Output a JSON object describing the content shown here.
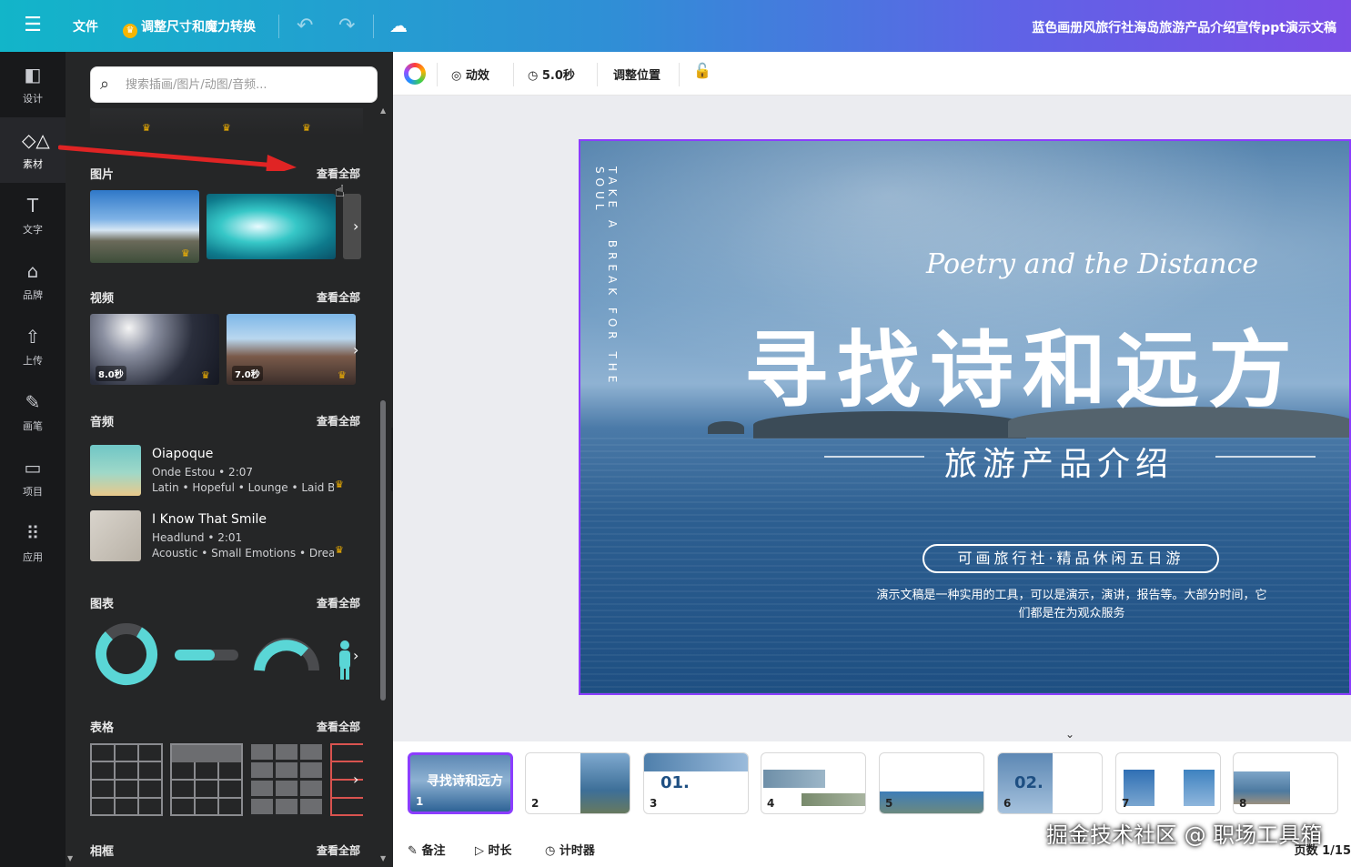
{
  "topbar": {
    "menu_icon": "menu-icon",
    "file_label": "文件",
    "resize_label": "调整尺寸和魔力转换",
    "doc_title": "蓝色画册风旅行社海岛旅游产品介绍宣传ppt演示文稿"
  },
  "rail": {
    "items": [
      {
        "icon": "design-icon",
        "label": "设计"
      },
      {
        "icon": "elements-icon",
        "label": "素材"
      },
      {
        "icon": "text-icon",
        "label": "文字"
      },
      {
        "icon": "brand-icon",
        "label": "品牌"
      },
      {
        "icon": "upload-icon",
        "label": "上传"
      },
      {
        "icon": "draw-icon",
        "label": "画笔"
      },
      {
        "icon": "projects-icon",
        "label": "项目"
      },
      {
        "icon": "apps-icon",
        "label": "应用"
      }
    ]
  },
  "panel": {
    "search_placeholder": "搜索插画/图片/动图/音频...",
    "see_all": "查看全部",
    "sections": {
      "photos": "图片",
      "videos": "视频",
      "audio": "音频",
      "charts": "图表",
      "tables": "表格",
      "frames": "相框"
    },
    "videos": [
      {
        "duration": "8.0秒"
      },
      {
        "duration": "7.0秒"
      }
    ],
    "audio": [
      {
        "title": "Oiapoque",
        "artist_duration": "Onde Estou • 2:07",
        "tags": "Latin • Hopeful • Lounge • Laid Bac"
      },
      {
        "title": "I Know That Smile",
        "artist_duration": "Headlund • 2:01",
        "tags": "Acoustic • Small Emotions • Dream"
      }
    ]
  },
  "toolbar": {
    "animate_label": "动效",
    "duration_label": "5.0秒",
    "position_label": "调整位置"
  },
  "slide": {
    "vertical_text": "TAKE A BREAK FOR THE SOUL",
    "script_title": "Poetry and the Distance",
    "main_title": "寻找诗和远方",
    "subtitle": "旅游产品介绍",
    "pill_text": "可画旅行社·精品休闲五日游",
    "description": "演示文稿是一种实用的工具，可以是演示，演讲，报告等。大部分时间，它们都是在为观众服务"
  },
  "pages": [
    "1",
    "2",
    "3",
    "4",
    "5",
    "6",
    "7",
    "8"
  ],
  "footer": {
    "notes_label": "备注",
    "duration_label": "时长",
    "timer_label": "计时器",
    "page_count": "页数 1/15",
    "watermark": "掘金技术社区 @ 职场工具箱"
  }
}
